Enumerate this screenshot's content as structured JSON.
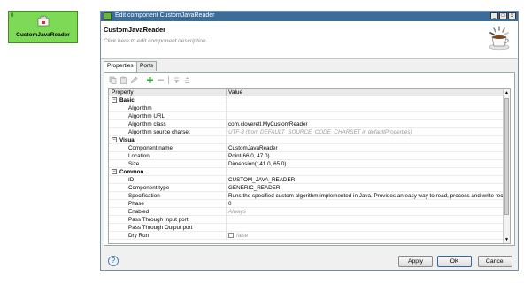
{
  "node": {
    "port": "0",
    "label": "CustomJavaReader"
  },
  "window": {
    "title": "Edit component CustomJavaReader",
    "buttons": [
      "_",
      "□",
      "x"
    ]
  },
  "header": {
    "name": "CustomJavaReader",
    "description": "Click here to edit component description..."
  },
  "tabs": [
    "Properties",
    "Ports"
  ],
  "table": {
    "columns": [
      "Property",
      "Value"
    ],
    "groups": [
      {
        "name": "Basic",
        "toggle": "−",
        "rows": [
          {
            "key": "Algorithm",
            "value": ""
          },
          {
            "key": "Algorithm URL",
            "value": ""
          },
          {
            "key": "Algorithm class",
            "value": "com.cloveretl.MyCustomReader"
          },
          {
            "key": "Algorithm source charset",
            "value": "UTF-8 (from DEFAULT_SOURCE_CODE_CHARSET in defaultProperties)"
          }
        ]
      },
      {
        "name": "Visual",
        "toggle": "−",
        "rows": [
          {
            "key": "Component name",
            "value": "CustomJavaReader"
          },
          {
            "key": "Location",
            "value": "Point(66.0, 47.0)"
          },
          {
            "key": "Size",
            "value": "Dimension(141.0, 65.0)"
          }
        ]
      },
      {
        "name": "Common",
        "toggle": "−",
        "rows": [
          {
            "key": "ID",
            "value": "CUSTOM_JAVA_READER"
          },
          {
            "key": "Component type",
            "value": "GENERIC_READER"
          },
          {
            "key": "Specification",
            "value": "Runs the specified custom algorithm implemented in Java. Provides an easy way to read, process and write reco..."
          },
          {
            "key": "Phase",
            "value": "0"
          },
          {
            "key": "Enabled",
            "value": "Always"
          },
          {
            "key": "Pass Through Input port",
            "value": ""
          },
          {
            "key": "Pass Through Output port",
            "value": ""
          },
          {
            "key": "Dry Run",
            "value": "false"
          }
        ]
      }
    ]
  },
  "footer": {
    "help": "?",
    "apply": "Apply",
    "ok": "OK",
    "cancel": "Cancel"
  }
}
